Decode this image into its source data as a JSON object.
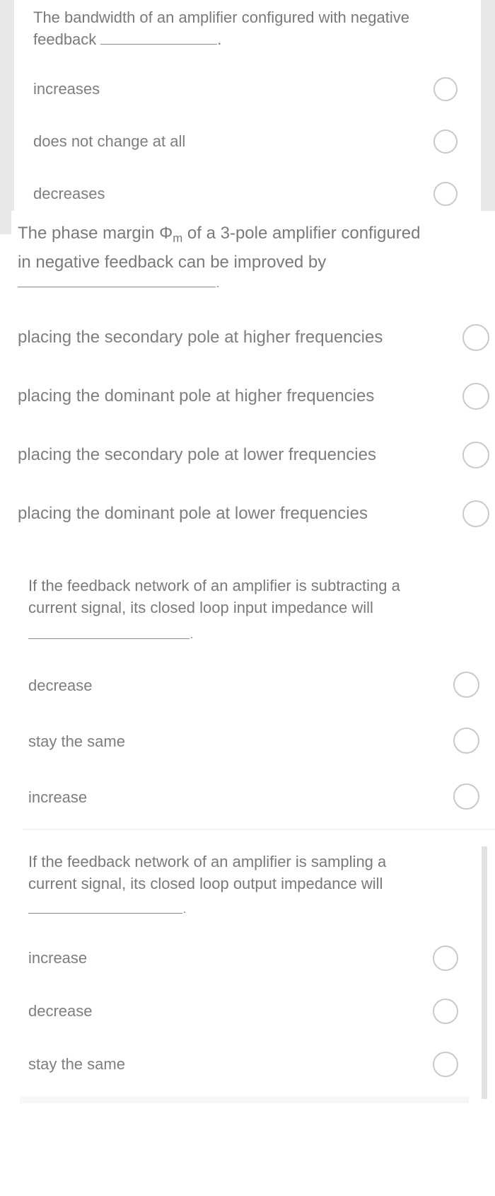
{
  "questions": [
    {
      "text_line1": "The bandwidth of an amplifier configured with negative",
      "text_line2": "feedback",
      "options": [
        "increases",
        "does not change at all",
        "decreases"
      ],
      "selected": null
    },
    {
      "text_pre": "The phase margin ",
      "symbol": "Φ",
      "symbol_sub": "m",
      "text_post": " of a 3-pole amplifier configured",
      "text_line2": "in negative feedback can be improved by",
      "options": [
        "placing the secondary pole at higher frequencies",
        "placing the dominant pole at higher frequencies",
        "placing the secondary pole at lower frequencies",
        "placing the dominant pole at lower frequencies"
      ],
      "selected": null
    },
    {
      "text_line1": "If the feedback network of an amplifier is subtracting a",
      "text_line2": "current signal, its closed loop input impedance will",
      "options": [
        "decrease",
        "stay the same",
        "increase"
      ],
      "selected": null
    },
    {
      "text_line1": "If the feedback network of an amplifier is sampling a",
      "text_line2": "current signal, its closed loop output impedance will",
      "options": [
        "increase",
        "decrease",
        "stay the same"
      ],
      "selected": null
    }
  ],
  "colors": {
    "text": "#7a7a7a",
    "radio_border": "#c9c9c9",
    "side_strip": "#e8e8e8"
  }
}
